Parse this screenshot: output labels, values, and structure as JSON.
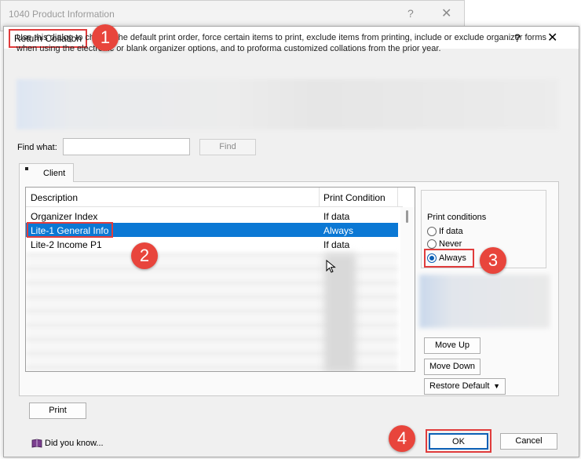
{
  "background_window": {
    "title": "1040 Product Information",
    "help": "?",
    "close": "✕"
  },
  "dialog": {
    "title": "Return Collation",
    "help": "?",
    "close": "✕",
    "description": "Use this dialog to change the default print order, force certain items to print, exclude items from printing, include or exclude organizer forms when using the electronic or blank organizer options, and to proforma customized collations from the prior year."
  },
  "find": {
    "label": "Find what:",
    "value": "",
    "button": "Find"
  },
  "tabs": [
    {
      "label": "Client",
      "active": true
    }
  ],
  "list": {
    "columns": [
      "Description",
      "Print Condition"
    ],
    "rows": [
      {
        "description": "Organizer Index",
        "condition": "If data",
        "selected": false
      },
      {
        "description": "Lite-1 General Info",
        "condition": "Always",
        "selected": true
      },
      {
        "description": "Lite-2 Income P1",
        "condition": "If data",
        "selected": false
      }
    ]
  },
  "print_conditions": {
    "title": "Print conditions",
    "options": [
      {
        "label": "If data",
        "selected": false
      },
      {
        "label": "Never",
        "selected": false
      },
      {
        "label": "Always",
        "selected": true
      }
    ]
  },
  "buttons": {
    "move_up": "Move Up",
    "move_down": "Move Down",
    "restore_default": "Restore Default",
    "print": "Print",
    "ok": "OK",
    "cancel": "Cancel"
  },
  "footer": {
    "did_you_know": "Did you know..."
  },
  "annotations": {
    "step1": "1",
    "step2": "2",
    "step3": "3",
    "step4": "4",
    "color": "#e8453c"
  },
  "colors": {
    "selection": "#0b78d4",
    "highlight_box": "#e03c3c"
  }
}
